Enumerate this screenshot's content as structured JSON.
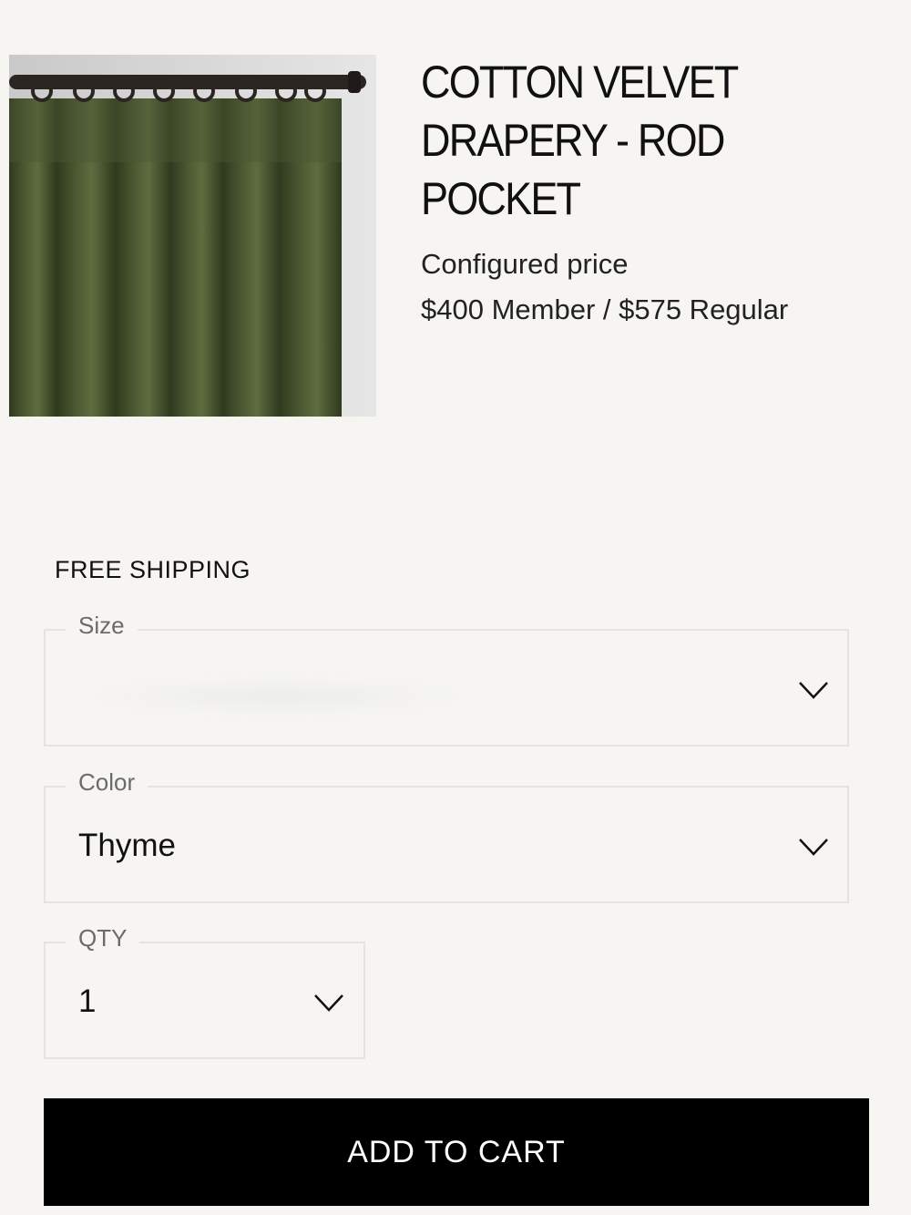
{
  "product": {
    "title": "COTTON VELVET DRAPERY - ROD POCKET",
    "image_icon": "velvet-curtain-image",
    "price_label": "Configured price",
    "price_values": "$400 Member / $575 Regular",
    "curtain_color": "#3f4a2a"
  },
  "shipping": {
    "label": "FREE SHIPPING"
  },
  "options": {
    "size": {
      "label": "Size",
      "value": ""
    },
    "color": {
      "label": "Color",
      "value": "Thyme"
    },
    "qty": {
      "label": "QTY",
      "value": "1"
    }
  },
  "cart": {
    "button_label": "ADD TO CART"
  },
  "colors": {
    "background": "#f6f5f2",
    "button": "#000000",
    "button_text": "#ffffff",
    "field_border": "#e3e3e1"
  },
  "icons": {
    "dropdown": "chevron-down-icon"
  }
}
